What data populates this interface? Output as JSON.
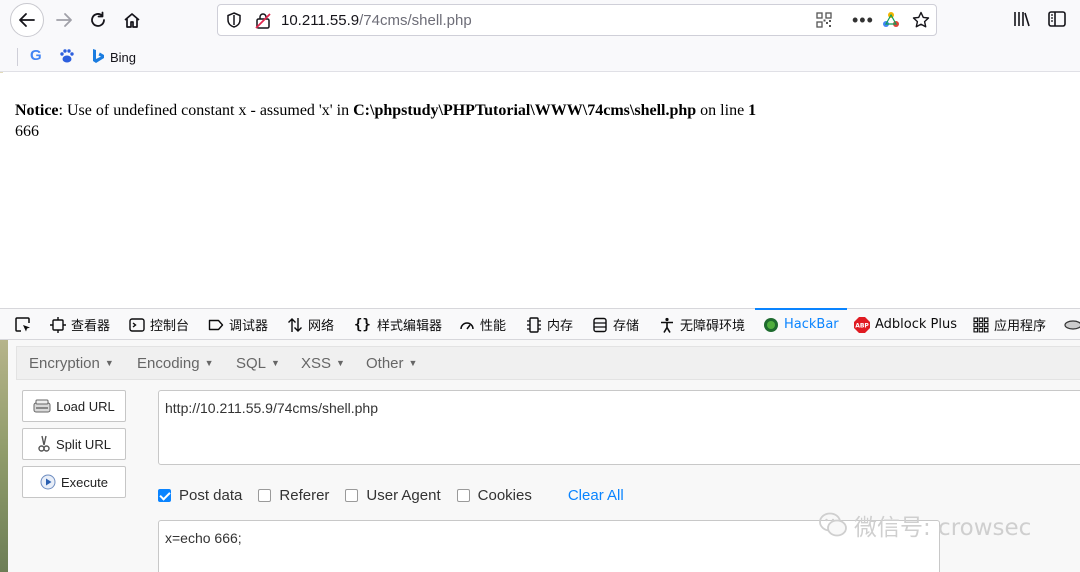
{
  "browser": {
    "url_host": "10.211.55.9",
    "url_path": "/74cms/shell.php",
    "bookmarks": [
      {
        "icon": "google-icon",
        "label": ""
      },
      {
        "icon": "baidu-icon",
        "label": ""
      },
      {
        "icon": "bing-icon",
        "label": "Bing"
      }
    ]
  },
  "page": {
    "notice_label": "Notice",
    "notice_text": ": Use of undefined constant x - assumed 'x' in ",
    "notice_path": "C:\\phpstudy\\PHPTutorial\\WWW\\74cms\\shell.php",
    "notice_online": " on line ",
    "notice_line": "1",
    "output": "666"
  },
  "devtools": {
    "tabs": [
      {
        "name": "inspector",
        "label": "查看器"
      },
      {
        "name": "console",
        "label": "控制台"
      },
      {
        "name": "debugger",
        "label": "调试器"
      },
      {
        "name": "network",
        "label": "网络"
      },
      {
        "name": "style-editor",
        "label": "样式编辑器"
      },
      {
        "name": "performance",
        "label": "性能"
      },
      {
        "name": "memory",
        "label": "内存"
      },
      {
        "name": "storage",
        "label": "存储"
      },
      {
        "name": "accessibility",
        "label": "无障碍环境"
      },
      {
        "name": "hackbar",
        "label": "HackBar"
      },
      {
        "name": "adblock",
        "label": "Adblock Plus"
      },
      {
        "name": "application",
        "label": "应用程序"
      }
    ],
    "active_tab": "HackBar"
  },
  "hackbar": {
    "menu": [
      "Encryption",
      "Encoding",
      "SQL",
      "XSS",
      "Other"
    ],
    "buttons": {
      "load": "Load URL",
      "split": "Split URL",
      "execute": "Execute"
    },
    "url_value": "http://10.211.55.9/74cms/shell.php",
    "options": [
      {
        "label": "Post data",
        "checked": true
      },
      {
        "label": "Referer",
        "checked": false
      },
      {
        "label": "User Agent",
        "checked": false
      },
      {
        "label": "Cookies",
        "checked": false
      }
    ],
    "clear_all": "Clear All",
    "post_value": "x=echo 666;"
  },
  "watermark": "微信号: crowsec",
  "colors": {
    "accent": "#0a84ff",
    "adblock": "#e01b22"
  }
}
